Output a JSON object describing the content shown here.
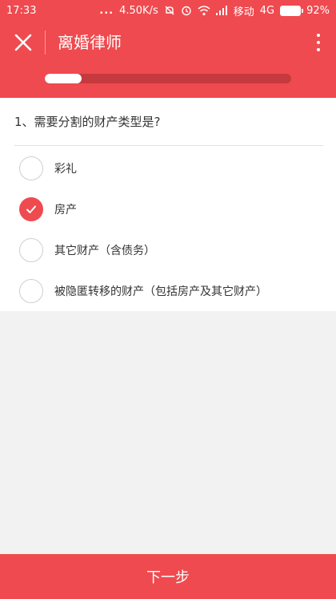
{
  "status_bar": {
    "time": "17:33",
    "dots": "...",
    "speed": "4.50K/s",
    "carrier": "移动",
    "network": "4G",
    "battery": "92%",
    "icons": [
      "mute-icon",
      "alarm-icon",
      "wifi-icon",
      "signal-icon",
      "battery-icon"
    ]
  },
  "appbar": {
    "title": "离婚律师",
    "close_icon": "close-icon",
    "more_icon": "more-vertical-icon",
    "progress": 0.15,
    "color": "#ef4a4f"
  },
  "question": {
    "text": "1、需要分割的财产类型是?",
    "options": [
      {
        "label": "彩礼",
        "checked": false
      },
      {
        "label": "房产",
        "checked": true
      },
      {
        "label": "其它财产（含债务）",
        "checked": false
      },
      {
        "label": "被隐匿转移的财产（包括房产及其它财产）",
        "checked": false
      }
    ]
  },
  "footer": {
    "next_label": "下一步"
  }
}
